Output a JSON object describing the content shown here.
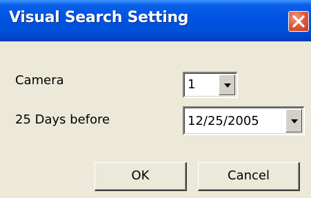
{
  "window": {
    "title": "Visual Search Setting",
    "close_icon": "close-icon"
  },
  "form": {
    "camera_label": "Camera",
    "camera_value": "1",
    "days_label": "25 Days before",
    "date_value": "12/25/2005"
  },
  "buttons": {
    "ok_label": "OK",
    "cancel_label": "Cancel"
  },
  "colors": {
    "titlebar": "#0054e3",
    "face": "#ece9d8",
    "close": "#e0583a"
  }
}
